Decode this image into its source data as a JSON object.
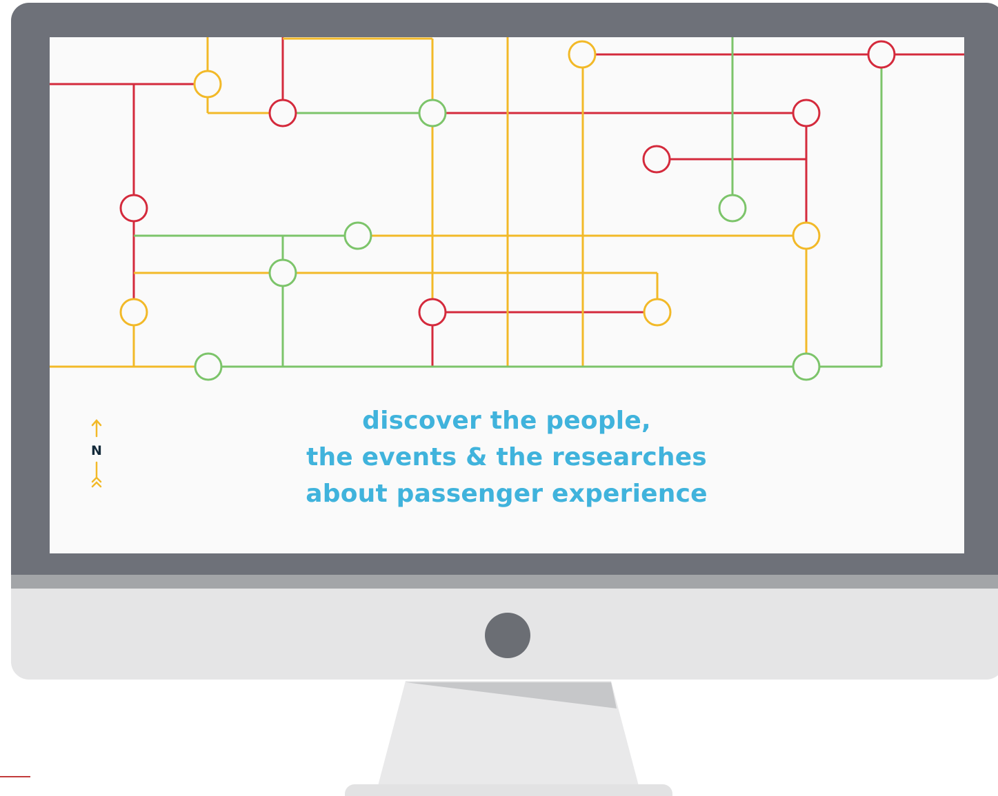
{
  "tagline": {
    "line1": "discover the people,",
    "line2": "the events & the researches",
    "line3": "about passenger experience"
  },
  "compass": {
    "letter": "N",
    "icon": "north-arrow-icon"
  },
  "colors": {
    "line_red": "#d42a3c",
    "line_yellow": "#f2b928",
    "line_green": "#7cc46a",
    "tagline": "#40b3dc",
    "bezel": "#6e7179",
    "chin": "#e5e5e6"
  }
}
